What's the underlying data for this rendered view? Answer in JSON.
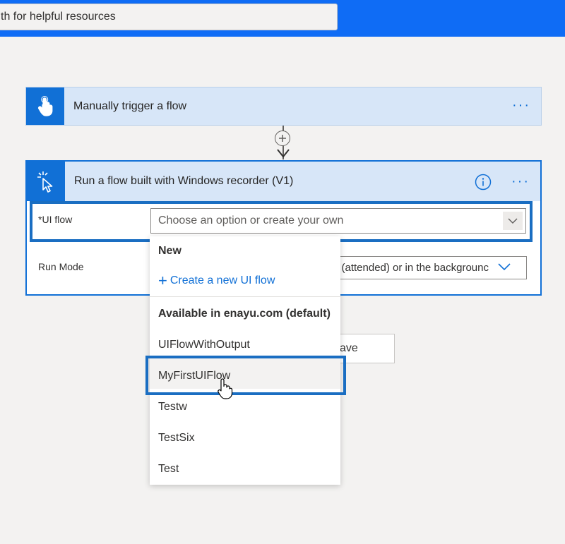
{
  "header": {
    "search_text": "th for helpful resources"
  },
  "trigger": {
    "title": "Manually trigger a flow",
    "more": "···"
  },
  "action": {
    "title": "Run a flow built with Windows recorder (V1)",
    "more": "···",
    "ui_flow": {
      "required_mark": "*",
      "label": "UI flow",
      "placeholder": "Choose an option or create your own"
    },
    "run_mode": {
      "label": "Run Mode",
      "value": "n (attended) or in the backgrounc"
    }
  },
  "save_button": {
    "label": "ave"
  },
  "dropdown": {
    "new_heading": "New",
    "create_label": "Create a new UI flow",
    "available_heading": "Available in enayu.com (default)",
    "options": [
      "UIFlowWithOutput",
      "MyFirstUIFlow",
      "Testw",
      "TestSix",
      "Test"
    ]
  },
  "colors": {
    "accent": "#1170d6",
    "topbar": "#0f6cf5",
    "card_header": "#d7e6f8",
    "highlight": "#1a6ec2"
  }
}
